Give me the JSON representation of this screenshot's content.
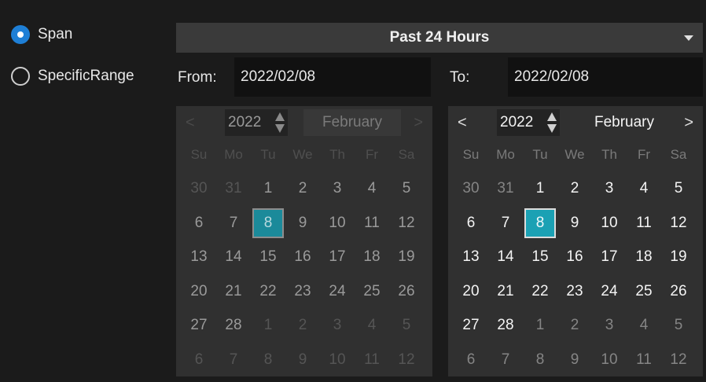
{
  "mode": {
    "span_label": "Span",
    "specific_range_label": "SpecificRange",
    "selected": "Span"
  },
  "span_dropdown": {
    "value": "Past 24 Hours"
  },
  "range": {
    "from_label": "From:",
    "from_value": "2022/02/08",
    "to_label": "To:",
    "to_value": "2022/02/08"
  },
  "calendar": {
    "weekdays": [
      "Su",
      "Mo",
      "Tu",
      "We",
      "Th",
      "Fr",
      "Sa"
    ],
    "days": [
      [
        30,
        31,
        1,
        2,
        3,
        4,
        5
      ],
      [
        6,
        7,
        8,
        9,
        10,
        11,
        12
      ],
      [
        13,
        14,
        15,
        16,
        17,
        18,
        19
      ],
      [
        20,
        21,
        22,
        23,
        24,
        25,
        26
      ],
      [
        27,
        28,
        1,
        2,
        3,
        4,
        5
      ],
      [
        6,
        7,
        8,
        9,
        10,
        11,
        12
      ]
    ],
    "selected_day": 8
  },
  "from_calendar": {
    "year": "2022",
    "month": "February",
    "prev": "<",
    "next": ">"
  },
  "to_calendar": {
    "year": "2022",
    "month": "February",
    "prev": "<",
    "next": ">"
  },
  "colors": {
    "accent": "#1e7fd6",
    "selected_day": "#1ba1b4",
    "panel": "#303030",
    "background": "#1b1b1b"
  },
  "icons": {
    "dropdown": "caret-down-icon",
    "spinner": "spinner-icon",
    "prev": "chevron-left-icon",
    "next": "chevron-right-icon"
  }
}
